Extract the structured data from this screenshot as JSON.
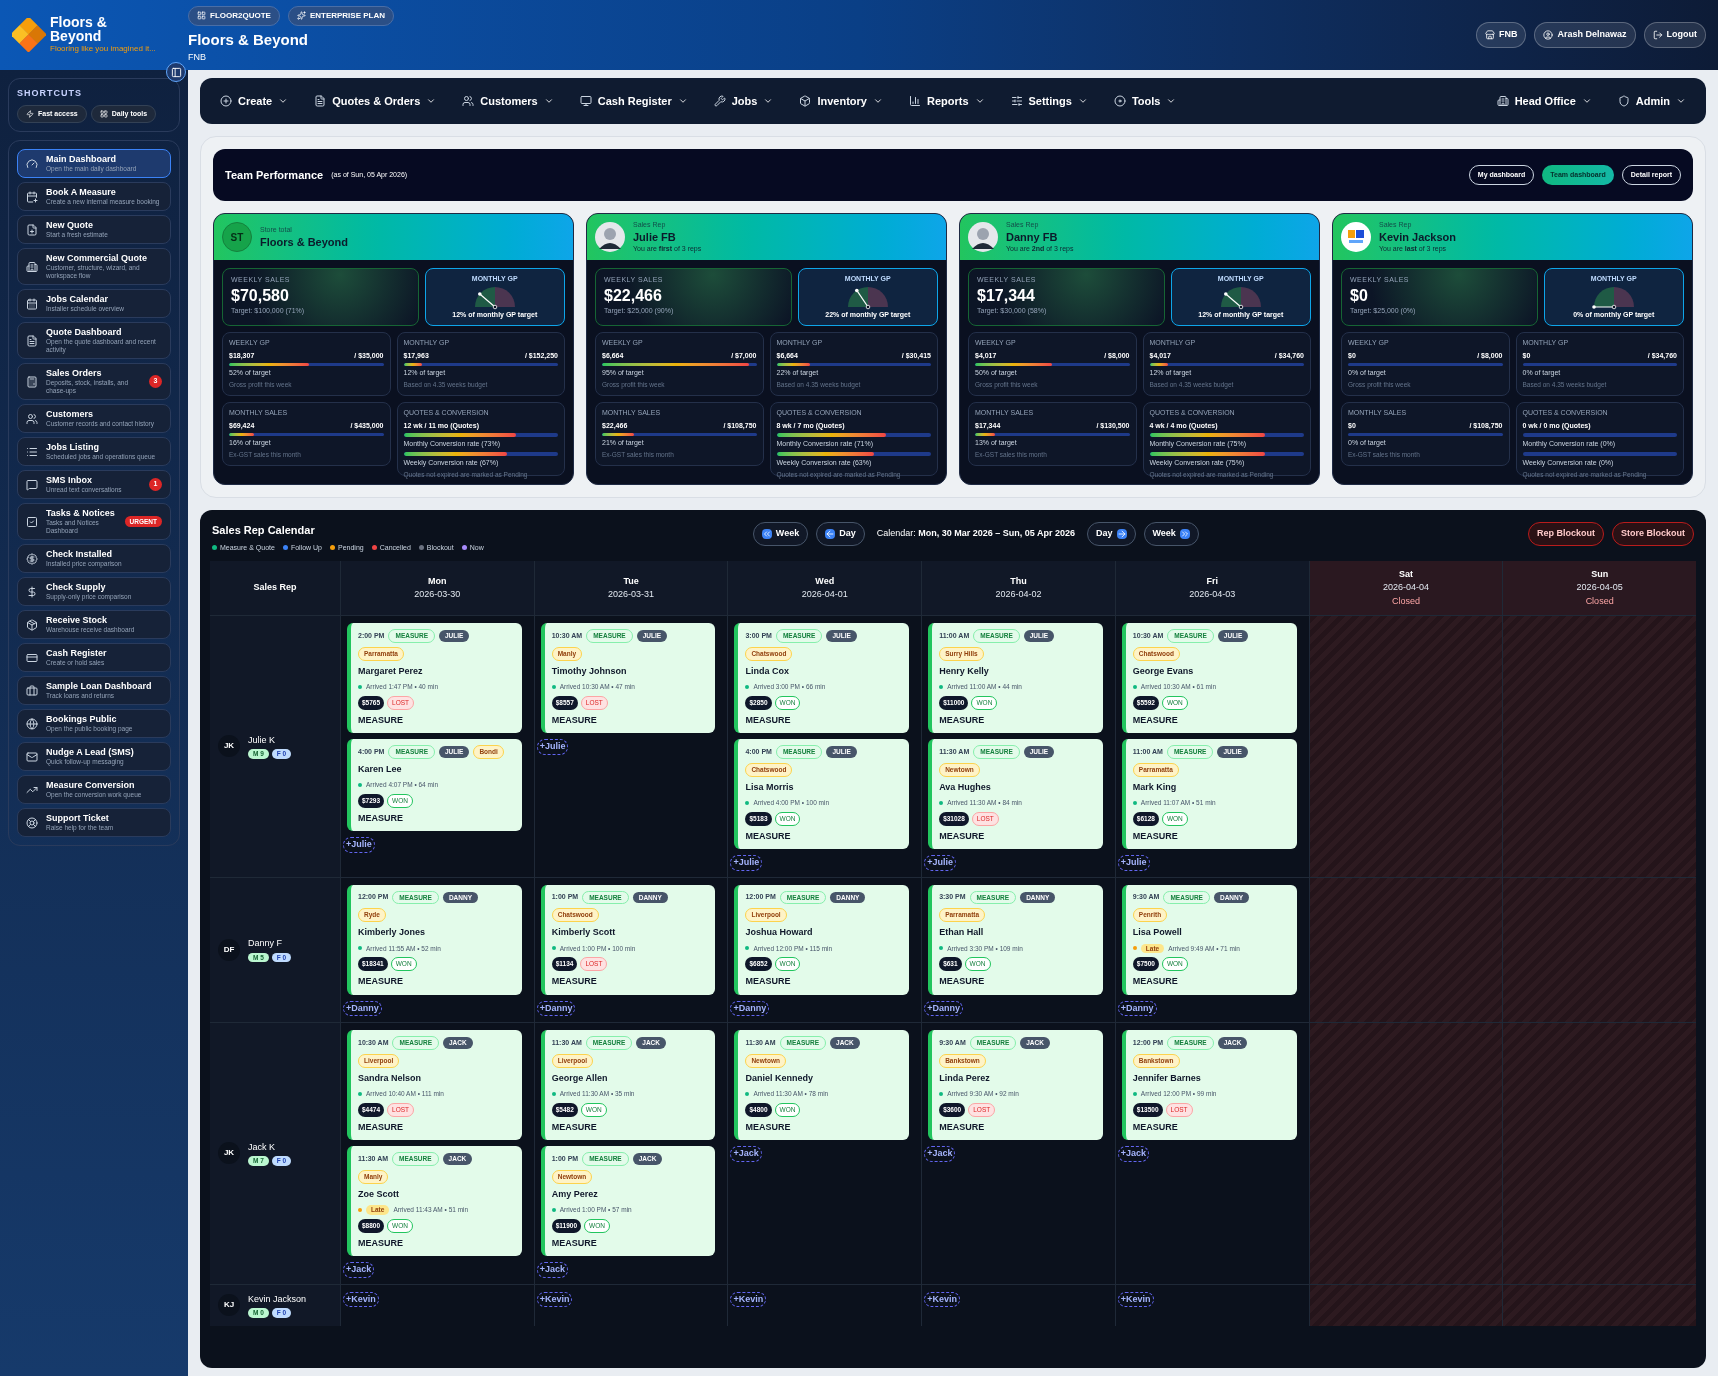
{
  "header": {
    "logo": {
      "name": "Floors & Beyond",
      "tagline": "Flooring like you imagined it..."
    },
    "badges": [
      "FLOOR2QUOTE",
      "ENTERPRISE PLAN"
    ],
    "title": "Floors & Beyond",
    "subtitle": "FNB",
    "actions": [
      "FNB",
      "Arash Delnawaz",
      "Logout"
    ]
  },
  "sidebar": {
    "title": "SHORTCUTS",
    "quick": [
      "Fast access",
      "Daily tools"
    ],
    "items": [
      {
        "title": "Main Dashboard",
        "sub": "Open the main daily dashboard",
        "selected": true
      },
      {
        "title": "Book A Measure",
        "sub": "Create a new internal measure booking",
        "selected": false
      },
      {
        "title": "New Quote",
        "sub": "Start a fresh estimate",
        "selected": false
      },
      {
        "title": "New Commercial Quote",
        "sub": "Customer, structure, wizard, and workspace flow",
        "selected": false
      },
      {
        "title": "Jobs Calendar",
        "sub": "Installer schedule overview",
        "selected": false
      },
      {
        "title": "Quote Dashboard",
        "sub": "Open the quote dashboard and recent activity",
        "selected": false
      },
      {
        "title": "Sales Orders",
        "sub": "Deposits, stock, installs, and chase-ups",
        "selected": false,
        "badge": {
          "kind": "count",
          "text": "3"
        }
      },
      {
        "title": "Customers",
        "sub": "Customer records and contact history",
        "selected": false
      },
      {
        "title": "Jobs Listing",
        "sub": "Scheduled jobs and operations queue",
        "selected": false
      },
      {
        "title": "SMS Inbox",
        "sub": "Unread text conversations",
        "selected": false,
        "badge": {
          "kind": "count",
          "text": "1"
        }
      },
      {
        "title": "Tasks & Notices",
        "sub": "Tasks and Notices Dashboard",
        "selected": false,
        "badge": {
          "kind": "urgent",
          "text": "URGENT"
        }
      },
      {
        "title": "Check Installed",
        "sub": "Installed price comparison",
        "selected": false
      },
      {
        "title": "Check Supply",
        "sub": "Supply-only price comparison",
        "selected": false
      },
      {
        "title": "Receive Stock",
        "sub": "Warehouse receive dashboard",
        "selected": false
      },
      {
        "title": "Cash Register",
        "sub": "Create or hold sales",
        "selected": false
      },
      {
        "title": "Sample Loan Dashboard",
        "sub": "Track loans and returns",
        "selected": false
      },
      {
        "title": "Bookings Public",
        "sub": "Open the public booking page",
        "selected": false
      },
      {
        "title": "Nudge A Lead (SMS)",
        "sub": "Quick follow-up messaging",
        "selected": false
      },
      {
        "title": "Measure Conversion",
        "sub": "Open the conversion work queue",
        "selected": false
      },
      {
        "title": "Support Ticket",
        "sub": "Raise help for the team",
        "selected": false
      }
    ]
  },
  "nav": {
    "items": [
      "Create",
      "Quotes & Orders",
      "Customers",
      "Cash Register",
      "Jobs",
      "Inventory",
      "Reports",
      "Settings",
      "Tools"
    ],
    "right": [
      "Head Office",
      "Admin"
    ]
  },
  "team": {
    "title": "Team Performance",
    "as_of": "(as of Sun, 05 Apr 2026)",
    "buttons": [
      {
        "label": "My dashboard",
        "selected": false
      },
      {
        "label": "Team dashboard",
        "selected": true
      },
      {
        "label": "Detail report",
        "selected": false
      }
    ],
    "cards": [
      {
        "role": "Store total",
        "name": "Floors & Beyond",
        "avatar": {
          "kind": "initials",
          "text": "ST"
        },
        "weekly_sales": {
          "label": "WEEKLY SALES",
          "value": "$70,580",
          "target": "Target: $100,000 (71%)"
        },
        "gauge": {
          "label": "MONTHLY GP",
          "level": 0.12,
          "caption": "12% of monthly GP target"
        },
        "metrics": [
          {
            "kind": "bar",
            "label": "WEEKLY GP",
            "value": "$18,307",
            "target": "/ $35,000",
            "level": 0.52,
            "percent": "52% of target",
            "note": "Gross profit this week"
          },
          {
            "kind": "bar",
            "label": "MONTHLY GP",
            "value": "$17,963",
            "target": "/ $152,250",
            "level": 0.12,
            "percent": "12% of target",
            "note": "Based on 4.35 weeks budget"
          },
          {
            "kind": "bar",
            "label": "MONTHLY SALES",
            "value": "$69,424",
            "target": "/ $435,000",
            "level": 0.16,
            "percent": "16% of target",
            "note": "Ex-GST sales this month"
          },
          {
            "kind": "quotes",
            "label": "QUOTES & CONVERSION",
            "headline": "12 wk / 11 mo (Quotes)",
            "rates": [
              {
                "label": "Monthly Conversion rate (73%)",
                "level": 0.73
              },
              {
                "label": "Weekly Conversion rate (67%)",
                "level": 0.67
              }
            ],
            "note": "Quotes not expired are marked as Pending"
          }
        ]
      },
      {
        "role": "Sales Rep",
        "name": "Julie FB",
        "rank": "You are **first** of 3 reps",
        "avatar": {
          "kind": "photo"
        },
        "weekly_sales": {
          "label": "WEEKLY SALES",
          "value": "$22,466",
          "target": "Target: $25,000 (90%)"
        },
        "gauge": {
          "label": "MONTHLY GP",
          "level": 0.22,
          "caption": "22% of monthly GP target"
        },
        "metrics": [
          {
            "kind": "bar",
            "label": "WEEKLY GP",
            "value": "$6,664",
            "target": "/ $7,000",
            "level": 0.95,
            "percent": "95% of target",
            "note": "Gross profit this week"
          },
          {
            "kind": "bar",
            "label": "MONTHLY GP",
            "value": "$6,664",
            "target": "/ $30,415",
            "level": 0.22,
            "percent": "22% of target",
            "note": "Based on 4.35 weeks budget"
          },
          {
            "kind": "bar",
            "label": "MONTHLY SALES",
            "value": "$22,466",
            "target": "/ $108,750",
            "level": 0.21,
            "percent": "21% of target",
            "note": "Ex-GST sales this month"
          },
          {
            "kind": "quotes",
            "label": "QUOTES & CONVERSION",
            "headline": "8 wk / 7 mo (Quotes)",
            "rates": [
              {
                "label": "Monthly Conversion rate (71%)",
                "level": 0.71
              },
              {
                "label": "Weekly Conversion rate (63%)",
                "level": 0.63
              }
            ],
            "note": "Quotes not expired are marked as Pending"
          }
        ]
      },
      {
        "role": "Sales Rep",
        "name": "Danny FB",
        "rank": "You are **2nd** of 3 reps",
        "avatar": {
          "kind": "photo"
        },
        "weekly_sales": {
          "label": "WEEKLY SALES",
          "value": "$17,344",
          "target": "Target: $30,000 (58%)"
        },
        "gauge": {
          "label": "MONTHLY GP",
          "level": 0.12,
          "caption": "12% of monthly GP target"
        },
        "metrics": [
          {
            "kind": "bar",
            "label": "WEEKLY GP",
            "value": "$4,017",
            "target": "/ $8,000",
            "level": 0.5,
            "percent": "50% of target",
            "note": "Gross profit this week"
          },
          {
            "kind": "bar",
            "label": "MONTHLY GP",
            "value": "$4,017",
            "target": "/ $34,760",
            "level": 0.12,
            "percent": "12% of target",
            "note": "Based on 4.35 weeks budget"
          },
          {
            "kind": "bar",
            "label": "MONTHLY SALES",
            "value": "$17,344",
            "target": "/ $130,500",
            "level": 0.13,
            "percent": "13% of target",
            "note": "Ex-GST sales this month"
          },
          {
            "kind": "quotes",
            "label": "QUOTES & CONVERSION",
            "headline": "4 wk / 4 mo (Quotes)",
            "rates": [
              {
                "label": "Monthly Conversion rate (75%)",
                "level": 0.75
              },
              {
                "label": "Weekly Conversion rate (75%)",
                "level": 0.75
              }
            ],
            "note": "Quotes not expired are marked as Pending"
          }
        ]
      },
      {
        "role": "Sales Rep",
        "name": "Kevin Jackson",
        "rank": "You are **last** of 3 reps",
        "avatar": {
          "kind": "logo"
        },
        "weekly_sales": {
          "label": "WEEKLY SALES",
          "value": "$0",
          "target": "Target: $25,000 (0%)"
        },
        "gauge": {
          "label": "MONTHLY GP",
          "level": 0,
          "caption": "0% of monthly GP target"
        },
        "metrics": [
          {
            "kind": "bar",
            "label": "WEEKLY GP",
            "value": "$0",
            "target": "/ $8,000",
            "level": 0,
            "percent": "0% of target",
            "note": "Gross profit this week"
          },
          {
            "kind": "bar",
            "label": "MONTHLY GP",
            "value": "$0",
            "target": "/ $34,760",
            "level": 0,
            "percent": "0% of target",
            "note": "Based on 4.35 weeks budget"
          },
          {
            "kind": "bar",
            "label": "MONTHLY SALES",
            "value": "$0",
            "target": "/ $108,750",
            "level": 0,
            "percent": "0% of target",
            "note": "Ex-GST sales this month"
          },
          {
            "kind": "quotes",
            "label": "QUOTES & CONVERSION",
            "headline": "0 wk / 0 mo (Quotes)",
            "rates": [
              {
                "label": "Monthly Conversion rate (0%)",
                "level": 0
              },
              {
                "label": "Weekly Conversion rate (0%)",
                "level": 0
              }
            ],
            "note": "Quotes not expired are marked as Pending"
          }
        ]
      }
    ]
  },
  "calendar": {
    "title": "Sales Rep Calendar",
    "legend": [
      {
        "label": "Measure & Quote",
        "color": "#10b981"
      },
      {
        "label": "Follow Up",
        "color": "#3b82f6"
      },
      {
        "label": "Pending",
        "color": "#f59e0b"
      },
      {
        "label": "Cancelled",
        "color": "#ef4444"
      },
      {
        "label": "Blockout",
        "color": "#6b7280"
      },
      {
        "label": "Now",
        "color": "#a78bfa"
      }
    ],
    "prev": [
      {
        "kind": "week",
        "label": "Week"
      },
      {
        "kind": "day",
        "label": "Day"
      }
    ],
    "range_label": "Calendar:",
    "range": "Mon, 30 Mar 2026 – Sun, 05 Apr 2026",
    "next": [
      {
        "kind": "day",
        "label": "Day"
      },
      {
        "kind": "week",
        "label": "Week"
      }
    ],
    "actions": [
      "Rep Blockout",
      "Store Blockout"
    ],
    "rep_heading": "Sales Rep",
    "columns": [
      {
        "day": "Mon",
        "date": "2026-03-30",
        "closed": false
      },
      {
        "day": "Tue",
        "date": "2026-03-31",
        "closed": false
      },
      {
        "day": "Wed",
        "date": "2026-04-01",
        "closed": false
      },
      {
        "day": "Thu",
        "date": "2026-04-02",
        "closed": false
      },
      {
        "day": "Fri",
        "date": "2026-04-03",
        "closed": false
      },
      {
        "day": "Sat",
        "date": "2026-04-04",
        "closed": true,
        "note": "Closed"
      },
      {
        "day": "Sun",
        "date": "2026-04-05",
        "closed": true,
        "note": "Closed"
      }
    ],
    "rows": [
      {
        "initials": "JK",
        "name": "Julie K",
        "measures": "M 9",
        "followups": "F 0",
        "days": [
          {
            "add": "+Julie",
            "appointments": [
              {
                "time": "2:00 PM",
                "type": "MEASURE",
                "rep": "JULIE",
                "suburb": "Parramatta",
                "customer": "Margaret Perez",
                "late": false,
                "arrived": "Arrived 1:47 PM • 40 min",
                "amount": "$5765",
                "outcome": "LOST",
                "won": false,
                "footer": "MEASURE"
              },
              {
                "time": "4:00 PM",
                "type": "MEASURE",
                "rep": "JULIE",
                "extra": "Bondi",
                "customer": "Karen Lee",
                "late": false,
                "arrived": "Arrived 4:07 PM • 64 min",
                "amount": "$7293",
                "outcome": "WON",
                "won": true,
                "footer": "MEASURE"
              }
            ]
          },
          {
            "add": "+Julie",
            "appointments": [
              {
                "time": "10:30 AM",
                "type": "MEASURE",
                "rep": "JULIE",
                "suburb": "Manly",
                "customer": "Timothy Johnson",
                "late": false,
                "arrived": "Arrived 10:30 AM • 47 min",
                "amount": "$8557",
                "outcome": "LOST",
                "won": false,
                "footer": "MEASURE"
              }
            ]
          },
          {
            "add": "+Julie",
            "appointments": [
              {
                "time": "3:00 PM",
                "type": "MEASURE",
                "rep": "JULIE",
                "suburb": "Chatswood",
                "customer": "Linda Cox",
                "late": false,
                "arrived": "Arrived 3:00 PM • 66 min",
                "amount": "$2850",
                "outcome": "WON",
                "won": true,
                "footer": "MEASURE"
              },
              {
                "time": "4:00 PM",
                "type": "MEASURE",
                "rep": "JULIE",
                "suburb": "Chatswood",
                "customer": "Lisa Morris",
                "late": false,
                "arrived": "Arrived 4:00 PM • 100 min",
                "amount": "$5183",
                "outcome": "WON",
                "won": true,
                "footer": "MEASURE"
              }
            ]
          },
          {
            "add": "+Julie",
            "appointments": [
              {
                "time": "11:00 AM",
                "type": "MEASURE",
                "rep": "JULIE",
                "suburb": "Surry Hills",
                "customer": "Henry Kelly",
                "late": false,
                "arrived": "Arrived 11:00 AM • 44 min",
                "amount": "$11000",
                "outcome": "WON",
                "won": true,
                "footer": "MEASURE"
              },
              {
                "time": "11:30 AM",
                "type": "MEASURE",
                "rep": "JULIE",
                "suburb": "Newtown",
                "customer": "Ava Hughes",
                "late": false,
                "arrived": "Arrived 11:30 AM • 84 min",
                "amount": "$31028",
                "outcome": "LOST",
                "won": false,
                "footer": "MEASURE"
              }
            ]
          },
          {
            "add": "+Julie",
            "appointments": [
              {
                "time": "10:30 AM",
                "type": "MEASURE",
                "rep": "JULIE",
                "suburb": "Chatswood",
                "customer": "George Evans",
                "late": false,
                "arrived": "Arrived 10:30 AM • 61 min",
                "amount": "$5592",
                "outcome": "WON",
                "won": true,
                "footer": "MEASURE"
              },
              {
                "time": "11:00 AM",
                "type": "MEASURE",
                "rep": "JULIE",
                "suburb": "Parramatta",
                "customer": "Mark King",
                "late": false,
                "arrived": "Arrived 11:07 AM • 51 min",
                "amount": "$6128",
                "outcome": "WON",
                "won": true,
                "footer": "MEASURE"
              }
            ]
          }
        ]
      },
      {
        "initials": "DF",
        "name": "Danny F",
        "measures": "M 5",
        "followups": "F 0",
        "days": [
          {
            "add": "+Danny",
            "appointments": [
              {
                "time": "12:00 PM",
                "type": "MEASURE",
                "rep": "DANNY",
                "suburb": "Ryde",
                "customer": "Kimberly Jones",
                "late": false,
                "arrived": "Arrived 11:55 AM • 52 min",
                "amount": "$18341",
                "outcome": "WON",
                "won": true,
                "footer": "MEASURE"
              }
            ]
          },
          {
            "add": "+Danny",
            "appointments": [
              {
                "time": "1:00 PM",
                "type": "MEASURE",
                "rep": "DANNY",
                "suburb": "Chatswood",
                "customer": "Kimberly Scott",
                "late": false,
                "arrived": "Arrived 1:00 PM • 100 min",
                "amount": "$1134",
                "outcome": "LOST",
                "won": false,
                "footer": "MEASURE"
              }
            ]
          },
          {
            "add": "+Danny",
            "appointments": [
              {
                "time": "12:00 PM",
                "type": "MEASURE",
                "rep": "DANNY",
                "suburb": "Liverpool",
                "customer": "Joshua Howard",
                "late": false,
                "arrived": "Arrived 12:00 PM • 115 min",
                "amount": "$6852",
                "outcome": "WON",
                "won": true,
                "footer": "MEASURE"
              }
            ]
          },
          {
            "add": "+Danny",
            "appointments": [
              {
                "time": "3:30 PM",
                "type": "MEASURE",
                "rep": "DANNY",
                "suburb": "Parramatta",
                "customer": "Ethan Hall",
                "late": false,
                "arrived": "Arrived 3:30 PM • 109 min",
                "amount": "$631",
                "outcome": "WON",
                "won": true,
                "footer": "MEASURE"
              }
            ]
          },
          {
            "add": "+Danny",
            "appointments": [
              {
                "time": "9:30 AM",
                "type": "MEASURE",
                "rep": "DANNY",
                "suburb": "Penrith",
                "customer": "Lisa Powell",
                "late": true,
                "late_label": "Late",
                "arrived": "Arrived 9:49 AM • 71 min",
                "amount": "$7500",
                "outcome": "WON",
                "won": true,
                "footer": "MEASURE"
              }
            ]
          }
        ]
      },
      {
        "initials": "JK",
        "name": "Jack K",
        "measures": "M 7",
        "followups": "F 0",
        "days": [
          {
            "add": "+Jack",
            "appointments": [
              {
                "time": "10:30 AM",
                "type": "MEASURE",
                "rep": "JACK",
                "suburb": "Liverpool",
                "customer": "Sandra Nelson",
                "late": false,
                "arrived": "Arrived 10:40 AM • 111 min",
                "amount": "$4474",
                "outcome": "LOST",
                "won": false,
                "footer": "MEASURE"
              },
              {
                "time": "11:30 AM",
                "type": "MEASURE",
                "rep": "JACK",
                "suburb": "Manly",
                "customer": "Zoe Scott",
                "late": true,
                "late_label": "Late",
                "arrived": "Arrived 11:43 AM • 51 min",
                "amount": "$8800",
                "outcome": "WON",
                "won": true,
                "footer": "MEASURE"
              }
            ]
          },
          {
            "add": "+Jack",
            "appointments": [
              {
                "time": "11:30 AM",
                "type": "MEASURE",
                "rep": "JACK",
                "suburb": "Liverpool",
                "customer": "George Allen",
                "late": false,
                "arrived": "Arrived 11:30 AM • 35 min",
                "amount": "$5482",
                "outcome": "WON",
                "won": true,
                "footer": "MEASURE"
              },
              {
                "time": "1:00 PM",
                "type": "MEASURE",
                "rep": "JACK",
                "suburb": "Newtown",
                "customer": "Amy Perez",
                "late": false,
                "arrived": "Arrived 1:00 PM • 57 min",
                "amount": "$11900",
                "outcome": "WON",
                "won": true,
                "footer": "MEASURE"
              }
            ]
          },
          {
            "add": "+Jack",
            "appointments": [
              {
                "time": "11:30 AM",
                "type": "MEASURE",
                "rep": "JACK",
                "suburb": "Newtown",
                "customer": "Daniel Kennedy",
                "late": false,
                "arrived": "Arrived 11:30 AM • 78 min",
                "amount": "$4800",
                "outcome": "WON",
                "won": true,
                "footer": "MEASURE"
              }
            ]
          },
          {
            "add": "+Jack",
            "appointments": [
              {
                "time": "9:30 AM",
                "type": "MEASURE",
                "rep": "JACK",
                "suburb": "Bankstown",
                "customer": "Linda Perez",
                "late": false,
                "arrived": "Arrived 9:30 AM • 92 min",
                "amount": "$3600",
                "outcome": "LOST",
                "won": false,
                "footer": "MEASURE"
              }
            ]
          },
          {
            "add": "+Jack",
            "appointments": [
              {
                "time": "12:00 PM",
                "type": "MEASURE",
                "rep": "JACK",
                "suburb": "Bankstown",
                "customer": "Jennifer Barnes",
                "late": false,
                "arrived": "Arrived 12:00 PM • 99 min",
                "amount": "$13500",
                "outcome": "LOST",
                "won": false,
                "footer": "MEASURE"
              }
            ]
          }
        ]
      },
      {
        "initials": "KJ",
        "name": "Kevin Jackson",
        "measures": "M 0",
        "followups": "F 0",
        "days": [
          {
            "add": "+Kevin"
          },
          {
            "add": "+Kevin"
          },
          {
            "add": "+Kevin"
          },
          {
            "add": "+Kevin"
          },
          {
            "add": "+Kevin"
          }
        ]
      }
    ]
  }
}
